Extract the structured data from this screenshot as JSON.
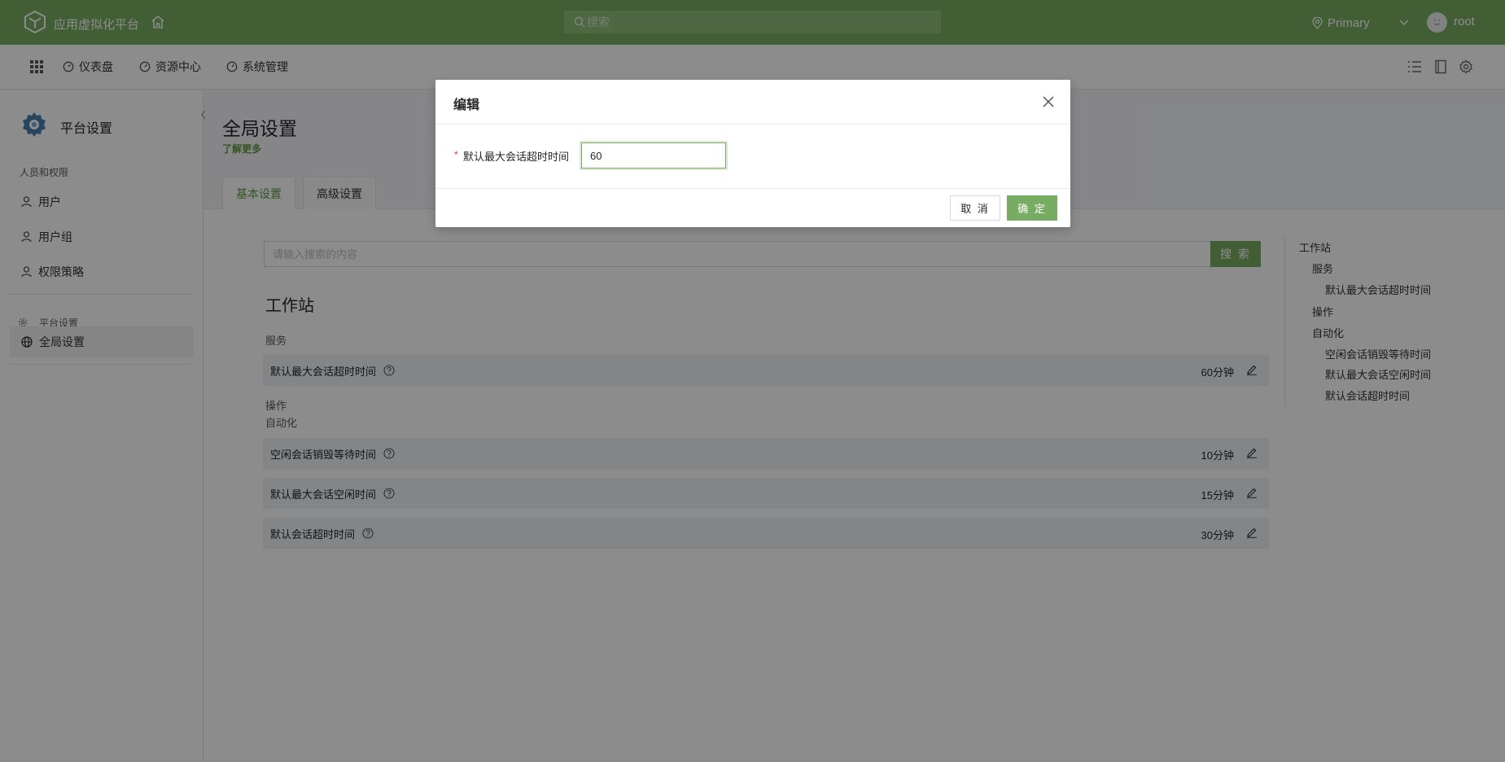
{
  "topbar": {
    "app_title": "应用虚拟化平台",
    "search_placeholder": "搜索",
    "region": "Primary",
    "username": "root"
  },
  "navbar": {
    "items": [
      {
        "label": "仪表盘",
        "icon": "dashboard-icon"
      },
      {
        "label": "资源中心",
        "icon": "dashboard-icon"
      },
      {
        "label": "系统管理",
        "icon": "dashboard-icon"
      }
    ],
    "right_icons": [
      "list-icon",
      "book-icon",
      "settings-icon"
    ]
  },
  "sidebar": {
    "title": "平台设置",
    "sections": [
      {
        "label": "人员和权限"
      },
      {
        "label": "平台设置"
      }
    ],
    "items": [
      {
        "label": "用户"
      },
      {
        "label": "用户组"
      },
      {
        "label": "权限策略"
      },
      {
        "label": "全局设置"
      }
    ]
  },
  "page": {
    "title": "全局设置",
    "learn_more": "了解更多",
    "tabs": [
      {
        "label": "基本设置",
        "active": true
      },
      {
        "label": "高级设置",
        "active": false
      }
    ],
    "search_placeholder": "请输入搜索的内容",
    "search_button": "搜 索",
    "section_title": "工作站",
    "groups": {
      "service": "服务",
      "operation": "操作",
      "automation": "自动化"
    },
    "rows": [
      {
        "label": "默认最大会话超时时间",
        "value": "60分钟"
      },
      {
        "label": "空闲会话销毁等待时间",
        "value": "10分钟"
      },
      {
        "label": "默认最大会话空闲时间",
        "value": "15分钟"
      },
      {
        "label": "默认会话超时时间",
        "value": "30分钟"
      }
    ]
  },
  "toc": [
    "工作站",
    "服务",
    "默认最大会话超时时间",
    "操作",
    "自动化",
    "空闲会话销毁等待时间",
    "默认最大会话空闲时间",
    "默认会话超时时间"
  ],
  "modal": {
    "title": "编辑",
    "field_label": "默认最大会话超时时间",
    "required_mark": "*",
    "field_value": "60",
    "cancel": "取 消",
    "ok": "确 定"
  },
  "colors": {
    "brand": "#77ac62",
    "brand_text": "#5d9b42"
  }
}
